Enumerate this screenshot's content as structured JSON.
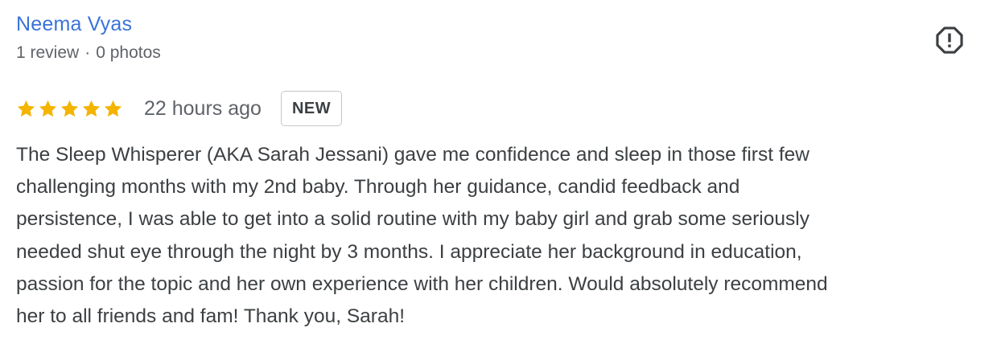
{
  "review": {
    "reviewer_name": "Neema Vyas",
    "reviewer_reviews": "1 review",
    "meta_separator": "·",
    "reviewer_photos": "0 photos",
    "rating": 5,
    "rating_max": 5,
    "time_ago": "22 hours ago",
    "badge": "NEW",
    "text": "The Sleep Whisperer (AKA Sarah Jessani) gave me confidence and sleep in those first few\nchallenging months with my 2nd baby. Through her guidance, candid feedback and\npersistence, I was able to get into a solid routine with my baby girl and grab some seriously\nneeded shut eye through the night by 3 months. I appreciate her background in education,\npassion for the topic and her own experience with her children. Would absolutely recommend\nher to all friends and fam! Thank you, Sarah!"
  },
  "colors": {
    "name_link": "#3a73d8",
    "star": "#f4b400",
    "meta_text": "#5f6368",
    "body_text": "#3c4043",
    "badge_border": "#c4c7c5"
  },
  "icons": {
    "report": "report-octagon-icon",
    "star": "star-icon"
  }
}
